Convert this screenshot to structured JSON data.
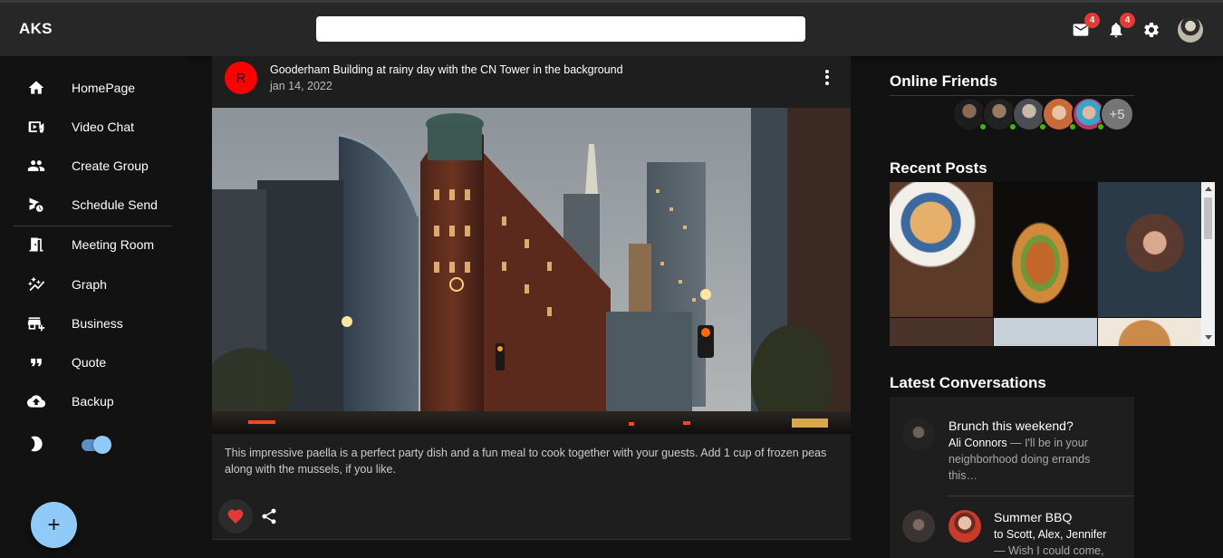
{
  "app": {
    "title": "AKS"
  },
  "search": {
    "placeholder": "",
    "value": ""
  },
  "header": {
    "mail_badge": "4",
    "notification_badge": "4",
    "icons": [
      "mail-icon",
      "notifications-icon",
      "settings-icon",
      "user-avatar"
    ]
  },
  "sidebar": {
    "items": [
      {
        "label": "HomePage",
        "icon": "home-icon"
      },
      {
        "label": "Video Chat",
        "icon": "video-chat-icon"
      },
      {
        "label": "Create Group",
        "icon": "group-icon"
      },
      {
        "label": "Schedule Send",
        "icon": "schedule-send-icon"
      },
      {
        "label": "Meeting Room",
        "icon": "meeting-room-icon"
      },
      {
        "label": "Graph",
        "icon": "auto-graph-icon"
      },
      {
        "label": "Business",
        "icon": "storefront-icon"
      },
      {
        "label": "Quote",
        "icon": "quote-icon"
      },
      {
        "label": "Backup",
        "icon": "cloud-upload-icon"
      }
    ],
    "dark_mode_icon": "moon-icon",
    "dark_mode_on": true,
    "fab_label": "+"
  },
  "post": {
    "avatar_letter": "R",
    "title": "Gooderham Building at rainy day with the CN Tower in the background",
    "date": "jan 14, 2022",
    "body": "This impressive paella is a perfect party dish and a fun meal to cook together with your guests. Add 1 cup of frozen peas along with the mussels, if you like.",
    "liked": true,
    "accent_color": "#e53935"
  },
  "right": {
    "online_friends_title": "Online Friends",
    "more_friends": "+5",
    "recent_posts_title": "Recent Posts",
    "latest_conversations_title": "Latest Conversations",
    "conversations": [
      {
        "title": "Brunch this weekend?",
        "sender": "Ali Connors",
        "snippet": " — I'll be in your neighborhood doing errands this…"
      },
      {
        "title": "Summer BBQ",
        "sender": "to Scott, Alex, Jennifer",
        "snippet": "— Wish I could come,"
      }
    ]
  }
}
